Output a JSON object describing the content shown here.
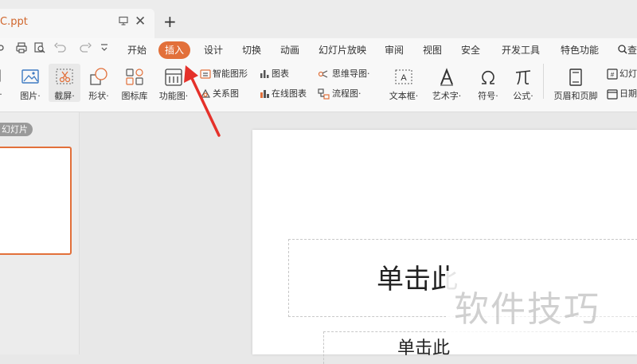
{
  "document_tab": {
    "title": "C.ppt",
    "pin_icon": "screen-icon",
    "close": "✕"
  },
  "new_tab": "+",
  "quick_access": {
    "icons": [
      "share-icon",
      "print-icon",
      "preview-icon",
      "undo-icon",
      "redo-icon",
      "customize-icon"
    ]
  },
  "menu": {
    "tabs": [
      {
        "label": "开始",
        "active": false
      },
      {
        "label": "插入",
        "active": true
      },
      {
        "label": "设计",
        "active": false
      },
      {
        "label": "切换",
        "active": false
      },
      {
        "label": "动画",
        "active": false
      },
      {
        "label": "幻灯片放映",
        "active": false
      },
      {
        "label": "审阅",
        "active": false
      },
      {
        "label": "视图",
        "active": false
      },
      {
        "label": "安全",
        "active": false
      },
      {
        "label": "开发工具",
        "active": false
      },
      {
        "label": "特色功能",
        "active": false
      }
    ],
    "search_label": "查"
  },
  "ribbon": {
    "partial_left_label": "·",
    "picture": "图片·",
    "screenshot": "截屏·",
    "shapes": "形状·",
    "icon_library": "图标库",
    "function_chart": "功能图·",
    "smart_art": "智能图形",
    "relation_chart": "关系图",
    "chart": "图表",
    "online_chart": "在线图表",
    "mind_map": "思维导图·",
    "flowchart": "流程图·",
    "text_box": "文本框·",
    "word_art": "艺术字·",
    "symbol": "符号·",
    "formula": "公式·",
    "header_footer": "页眉和页脚",
    "slide_number": "幻灯",
    "date": "日期"
  },
  "left_panel": {
    "label": "幻灯片"
  },
  "slide": {
    "title_placeholder": "单击此",
    "subtitle_placeholder": "单击此"
  },
  "watermark": "软件技巧",
  "colors": {
    "accent": "#e2703a",
    "annotation_arrow": "#e5312a"
  }
}
